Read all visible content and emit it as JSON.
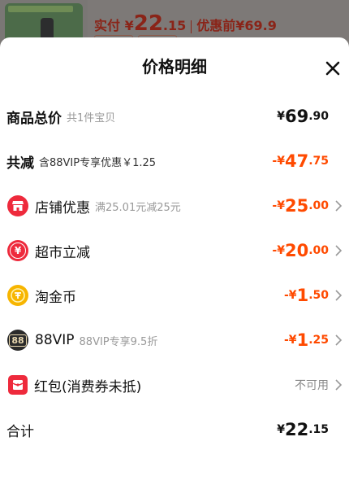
{
  "background": {
    "paid_label": "实付",
    "paid_currency": "¥",
    "paid_int": "22",
    "paid_dec": ".15",
    "before_label": "优惠前",
    "before_price": "¥69.9"
  },
  "sheet": {
    "title": "价格明细",
    "close_icon": "close-icon"
  },
  "rows": {
    "total": {
      "label": "商品总价",
      "sub": "共1件宝贝",
      "cur": "¥",
      "int": "69",
      "dec": ".90"
    },
    "reduce": {
      "label": "共减",
      "sub": "含88VIP专享优惠￥1.25",
      "cur": "-¥",
      "int": "47",
      "dec": ".75"
    },
    "shop": {
      "label": "店铺优惠",
      "sub": "满25.01元减25元",
      "cur": "-¥",
      "int": "25",
      "dec": ".00",
      "icon": "shop-icon"
    },
    "market": {
      "label": "超市立减",
      "sub": "",
      "cur": "-¥",
      "int": "20",
      "dec": ".00",
      "icon": "yen-icon"
    },
    "coin": {
      "label": "淘金币",
      "sub": "",
      "cur": "-¥",
      "int": "1",
      "dec": ".50",
      "icon": "coin-icon"
    },
    "vip": {
      "label": "88VIP",
      "sub": "88VIP专享9.5折",
      "cur": "-¥",
      "int": "1",
      "dec": ".25",
      "icon": "vip88-icon",
      "icon_text": "88"
    },
    "redpacket": {
      "label": "红包(消费券未抵)",
      "sub": "",
      "status": "不可用",
      "icon": "red-packet-icon"
    },
    "sum": {
      "label": "合计",
      "cur": "¥",
      "int": "22",
      "dec": ".15"
    }
  },
  "colors": {
    "accent": "#ff4a00",
    "icon_red": "#ee2a3c",
    "icon_gold": "#f7b500",
    "icon_dark": "#2b2b2b"
  }
}
